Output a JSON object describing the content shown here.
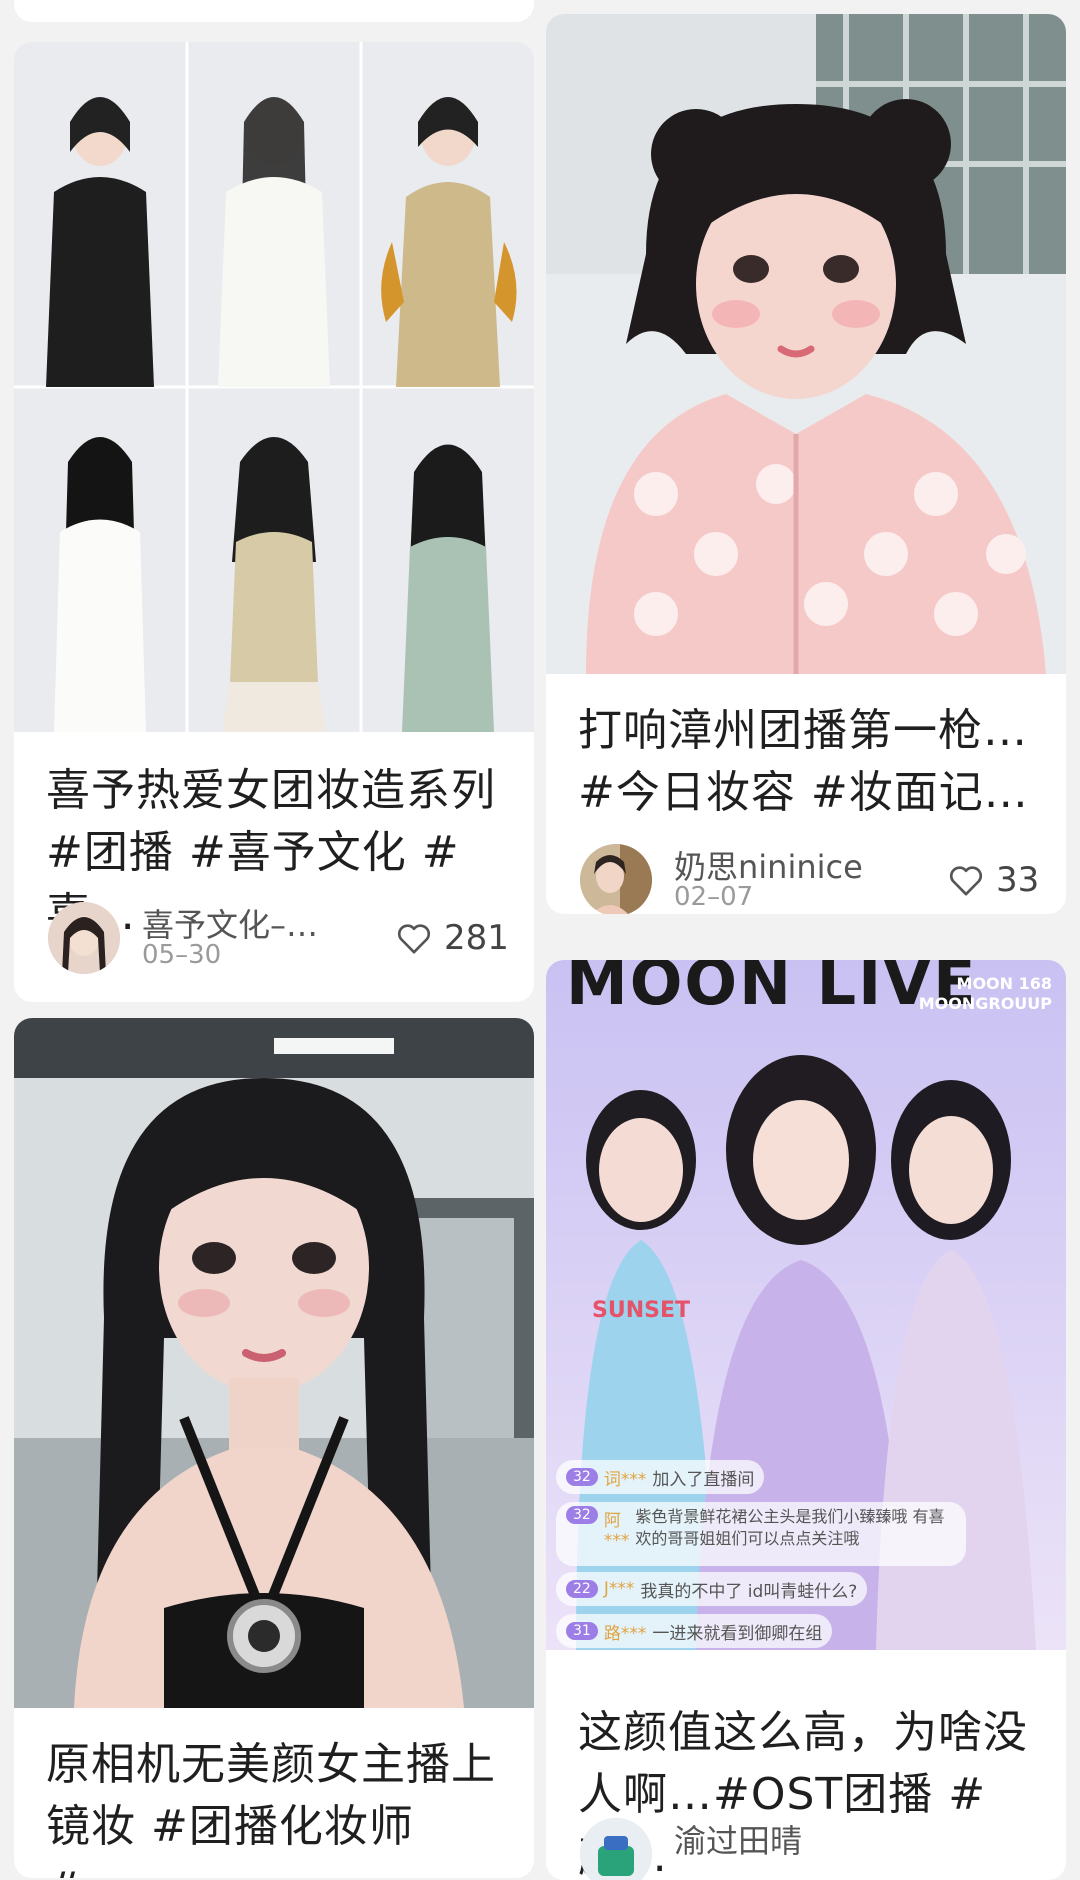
{
  "feed": {
    "cards": [
      {
        "title": "喜予热爱女团妆造系列\n#团播 #喜予文化 #喜…",
        "author": "喜予文化–…",
        "date": "05–30",
        "likes": "281"
      },
      {
        "title": "打响漳州团播第一枪…\n#今日妆容 #妆面记…",
        "author": "奶思nininice",
        "date": "02–07",
        "likes": "33"
      },
      {
        "title": "原相机无美颜女主播上\n镜妆 #团播化妆师 #…"
      },
      {
        "title": "这颜值这么高，为啥没\n人啊…#OST团播 #颜…",
        "author": "渝过田晴",
        "overlay": {
          "banner": "MOON LIVE",
          "brand_line1": "MOON 168",
          "brand_line2": "MOONGROUUP",
          "shirt_text": "SUNSET",
          "chat": [
            {
              "level": "32",
              "name": "词***",
              "text": "加入了直播间"
            },
            {
              "level": "32",
              "name": "阿***",
              "text": "紫色背景鲜花裙公主头是我们小臻臻哦 有喜欢的哥哥姐姐们可以点点关注哦"
            },
            {
              "level": "22",
              "name": "J***",
              "text": "我真的不中了 id叫青蛙什么?"
            },
            {
              "level": "31",
              "name": "路***",
              "text": "一进来就看到御卿在组"
            }
          ]
        }
      }
    ]
  },
  "colors": {
    "page_bg": "#f2f2f2",
    "card_bg": "#ffffff",
    "title_text": "#1f1f1f",
    "meta_text": "#9a9a9a"
  },
  "icons": [
    "heart-icon"
  ]
}
